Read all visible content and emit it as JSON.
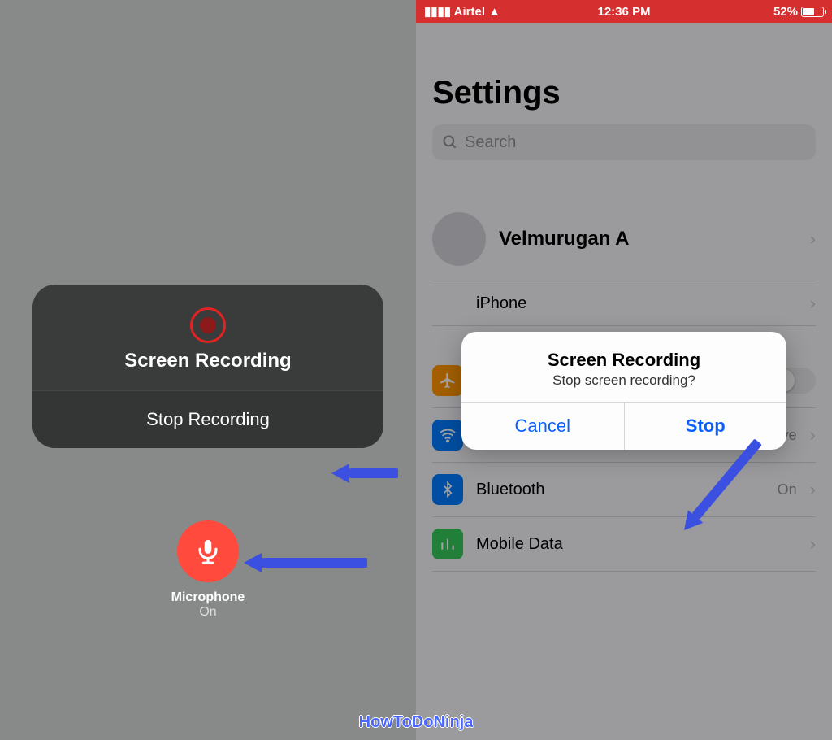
{
  "left": {
    "card_title": "Screen Recording",
    "stop_label": "Stop Recording",
    "mic_label": "Microphone",
    "mic_state": "On"
  },
  "right": {
    "status": {
      "carrier": "Airtel",
      "time": "12:36 PM",
      "battery_pct": "52%"
    },
    "title": "Settings",
    "search_placeholder": "Search",
    "profile_name": "Velmurugan A",
    "iphone_row_label": "iPhone",
    "rows": {
      "airplane": "Airplane Mode",
      "wifi": "Wi-Fi",
      "wifi_value": "Mancave",
      "bluetooth": "Bluetooth",
      "bluetooth_value": "On",
      "mobile": "Mobile Data"
    },
    "alert": {
      "title": "Screen Recording",
      "message": "Stop screen recording?",
      "cancel": "Cancel",
      "stop": "Stop"
    }
  },
  "watermark": "HowToDoNinja"
}
